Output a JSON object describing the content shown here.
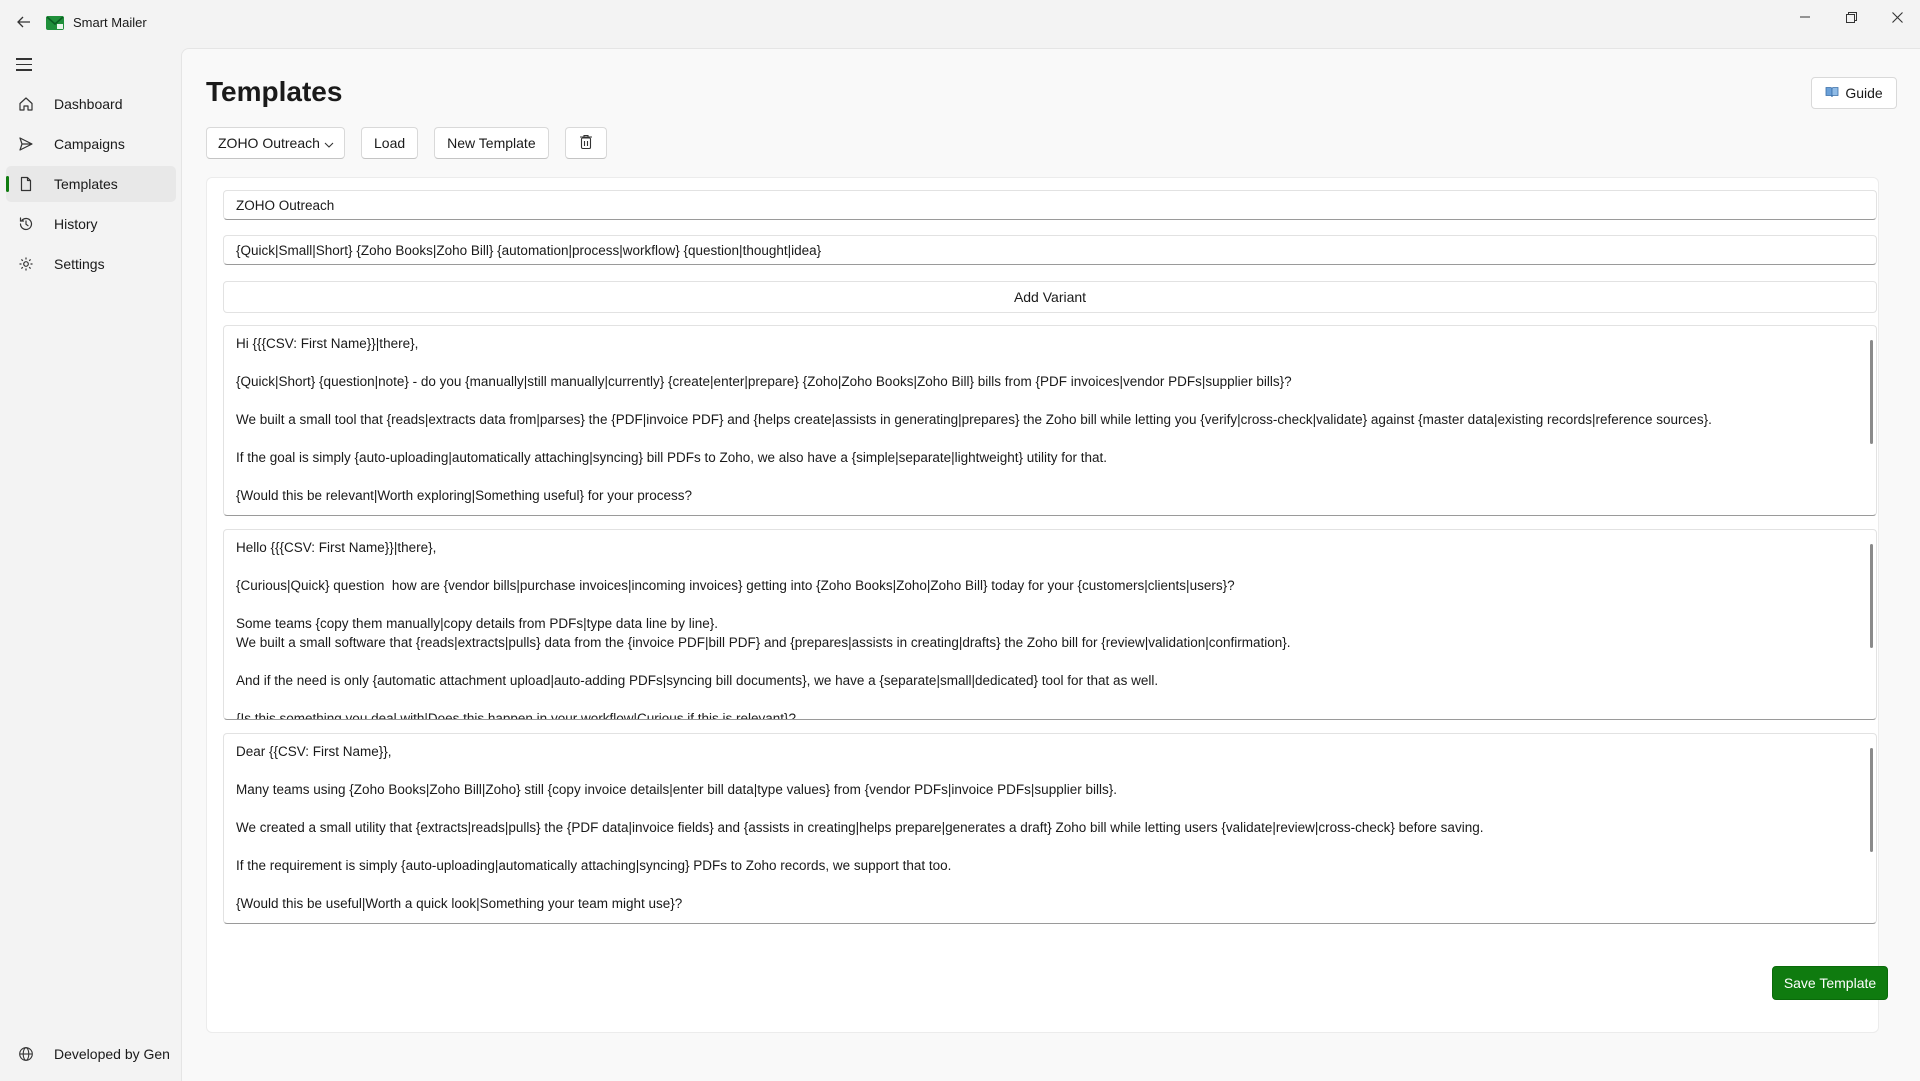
{
  "app": {
    "title": "Smart Mailer",
    "accent_color": "#107c10"
  },
  "sidebar": {
    "items": [
      {
        "label": "Dashboard",
        "icon": "home-icon"
      },
      {
        "label": "Campaigns",
        "icon": "send-icon"
      },
      {
        "label": "Templates",
        "icon": "document-icon",
        "active": true
      },
      {
        "label": "History",
        "icon": "history-icon"
      },
      {
        "label": "Settings",
        "icon": "gear-icon"
      }
    ],
    "footer_label": "Developed by Gen"
  },
  "page": {
    "title": "Templates",
    "guide_label": "Guide"
  },
  "toolbar": {
    "template_select_value": "ZOHO Outreach",
    "load_label": "Load",
    "new_label": "New Template"
  },
  "form": {
    "name_value": "ZOHO Outreach",
    "subject_value": "{Quick|Small|Short} {Zoho Books|Zoho Bill} {automation|process|workflow} {question|thought|idea}",
    "add_variant_label": "Add Variant",
    "variants": [
      "Hi {{{CSV: First Name}}|there},\n\n{Quick|Short} {question|note} - do you {manually|still manually|currently} {create|enter|prepare} {Zoho|Zoho Books|Zoho Bill} bills from {PDF invoices|vendor PDFs|supplier bills}?\n\nWe built a small tool that {reads|extracts data from|parses} the {PDF|invoice PDF} and {helps create|assists in generating|prepares} the Zoho bill while letting you {verify|cross-check|validate} against {master data|existing records|reference sources}.\n\nIf the goal is simply {auto-uploading|automatically attaching|syncing} bill PDFs to Zoho, we also have a {simple|separate|lightweight} utility for that.\n\n{Would this be relevant|Worth exploring|Something useful} for your process?",
      "Hello {{{CSV: First Name}}|there},\n\n{Curious|Quick} question  how are {vendor bills|purchase invoices|incoming invoices} getting into {Zoho Books|Zoho|Zoho Bill} today for your {customers|clients|users}?\n\nSome teams {copy them manually|copy details from PDFs|type data line by line}.\nWe built a small software that {reads|extracts|pulls} data from the {invoice PDF|bill PDF} and {prepares|assists in creating|drafts} the Zoho bill for {review|validation|confirmation}.\n\nAnd if the need is only {automatic attachment upload|auto-adding PDFs|syncing bill documents}, we have a {separate|small|dedicated} tool for that as well.\n\n{Is this something you deal with|Does this happen in your workflow|Curious if this is relevant}?",
      "Dear {{CSV: First Name}},\n\nMany teams using {Zoho Books|Zoho Bill|Zoho} still {copy invoice details|enter bill data|type values} from {vendor PDFs|invoice PDFs|supplier bills}.\n\nWe created a small utility that {extracts|reads|pulls} the {PDF data|invoice fields} and {assists in creating|helps prepare|generates a draft} Zoho bill while letting users {validate|review|cross-check} before saving.\n\nIf the requirement is simply {auto-uploading|automatically attaching|syncing} PDFs to Zoho records, we support that too.\n\n{Would this be useful|Worth a quick look|Something your team might use}?"
    ],
    "save_label": "Save Template"
  }
}
